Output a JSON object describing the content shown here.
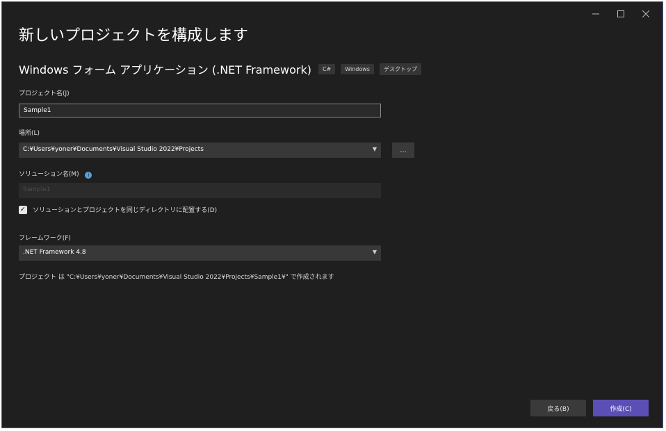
{
  "dialog": {
    "title": "新しいプロジェクトを構成します",
    "template_name": "Windows フォーム アプリケーション (.NET Framework)",
    "tags": [
      "C#",
      "Windows",
      "デスクトップ"
    ]
  },
  "form": {
    "project_name_label": "プロジェクト名(J)",
    "project_name_value": "Sample1",
    "location_label": "場所(L)",
    "location_value": "C:¥Users¥yoner¥Documents¥Visual Studio 2022¥Projects",
    "browse_label": "...",
    "solution_name_label": "ソリューション名(M)",
    "solution_name_value": "Sample1",
    "same_dir_checkbox_label": "ソリューションとプロジェクトを同じディレクトリに配置する(D)",
    "same_dir_checked": true,
    "framework_label": "フレームワーク(F)",
    "framework_value": ".NET Framework 4.8",
    "path_note": "プロジェクト は \"C:¥Users¥yoner¥Documents¥Visual Studio 2022¥Projects¥Sample1¥\" で作成されます"
  },
  "footer": {
    "back_label": "戻る(B)",
    "create_label": "作成(C)"
  },
  "window_controls": {
    "minimize_icon": "minimize-icon",
    "maximize_icon": "maximize-icon",
    "close_icon": "close-icon"
  },
  "colors": {
    "background": "#1f1f1f",
    "accent": "#5b4fb5"
  }
}
